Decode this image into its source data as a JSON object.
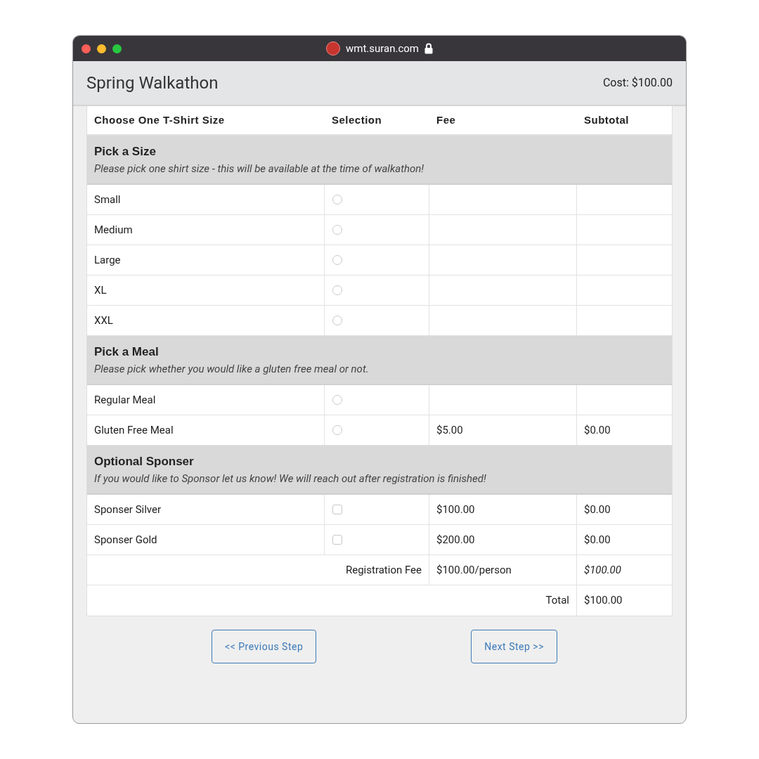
{
  "window": {
    "url": "wmt.suran.com",
    "secure": true
  },
  "header": {
    "title": "Spring Walkathon",
    "cost": "Cost: $100.00"
  },
  "table": {
    "columns": [
      "Choose One T-Shirt Size",
      "Selection",
      "Fee",
      "Subtotal"
    ],
    "sections": [
      {
        "title": "Pick a Size",
        "description": "Please pick one shirt size - this will be available at the time of walkathon!",
        "rows": [
          {
            "label": "Small",
            "kind": "radio",
            "checked": false
          },
          {
            "label": "Medium",
            "kind": "radio",
            "checked": false
          },
          {
            "label": "Large",
            "kind": "radio",
            "checked": false
          },
          {
            "label": "XL",
            "kind": "radio",
            "checked": false
          },
          {
            "label": "XXL",
            "kind": "radio",
            "checked": false
          }
        ]
      },
      {
        "title": "Pick a Meal",
        "description": "Please pick whether you would like a gluten free meal or not.",
        "rows": [
          {
            "label": "Regular Meal",
            "kind": "radio",
            "checked": false
          },
          {
            "label": "Gluten Free Meal",
            "kind": "radio",
            "checked": false,
            "fee": "$5.00",
            "subtotal": "$0.00"
          }
        ]
      },
      {
        "title": "Optional Sponser",
        "description": "If you would like to Sponsor let us know! We will reach out after registration is finished!",
        "rows": [
          {
            "label": "Sponser Silver",
            "kind": "checkbox",
            "checked": false,
            "fee": "$100.00",
            "subtotal": "$0.00"
          },
          {
            "label": "Sponser Gold",
            "kind": "checkbox",
            "checked": false,
            "fee": "$200.00",
            "subtotal": "$0.00"
          }
        ]
      }
    ],
    "registration": {
      "label": "Registration Fee",
      "fee": "$100.00/person",
      "subtotal": "$100.00"
    },
    "total": {
      "label": "Total",
      "value": "$100.00"
    }
  },
  "buttons": [
    "<< Previous Step",
    "Next Step >>"
  ]
}
